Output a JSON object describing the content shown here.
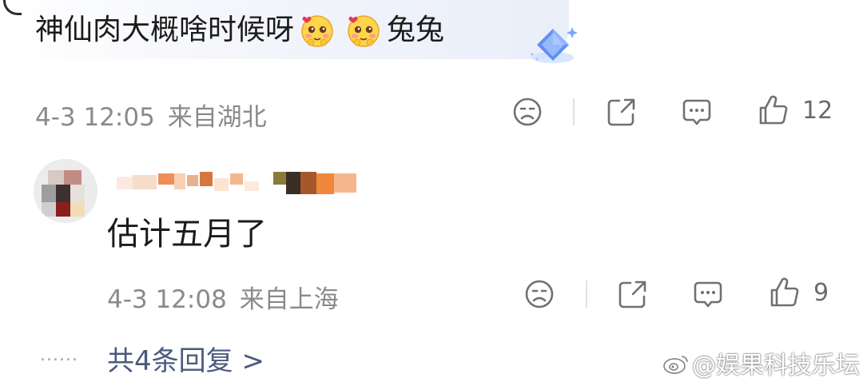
{
  "comment": {
    "text_part1": "神仙肉大概啥时候呀",
    "text_part2": "兔兔",
    "emoji": [
      "blush-face-hearts",
      "blush-face-hearts"
    ],
    "timestamp": "4-3 12:05",
    "location": "来自湖北",
    "like_count": "12"
  },
  "reply": {
    "text": "估计五月了",
    "timestamp": "4-3 12:08",
    "location": "来自上海",
    "like_count": "9"
  },
  "more_replies": {
    "dots": "......",
    "label": "共4条回复 >"
  },
  "watermark": "@娱果科技乐坛",
  "colors": {
    "meta_gray": "#8a8a8a",
    "link_blue": "#4a5a7d",
    "badge_blue": "#5f8ff0"
  },
  "icons": [
    "sad-face-icon",
    "share-icon",
    "comment-icon",
    "like-thumb-icon",
    "crystal-badge-icon",
    "weibo-logo-icon"
  ]
}
